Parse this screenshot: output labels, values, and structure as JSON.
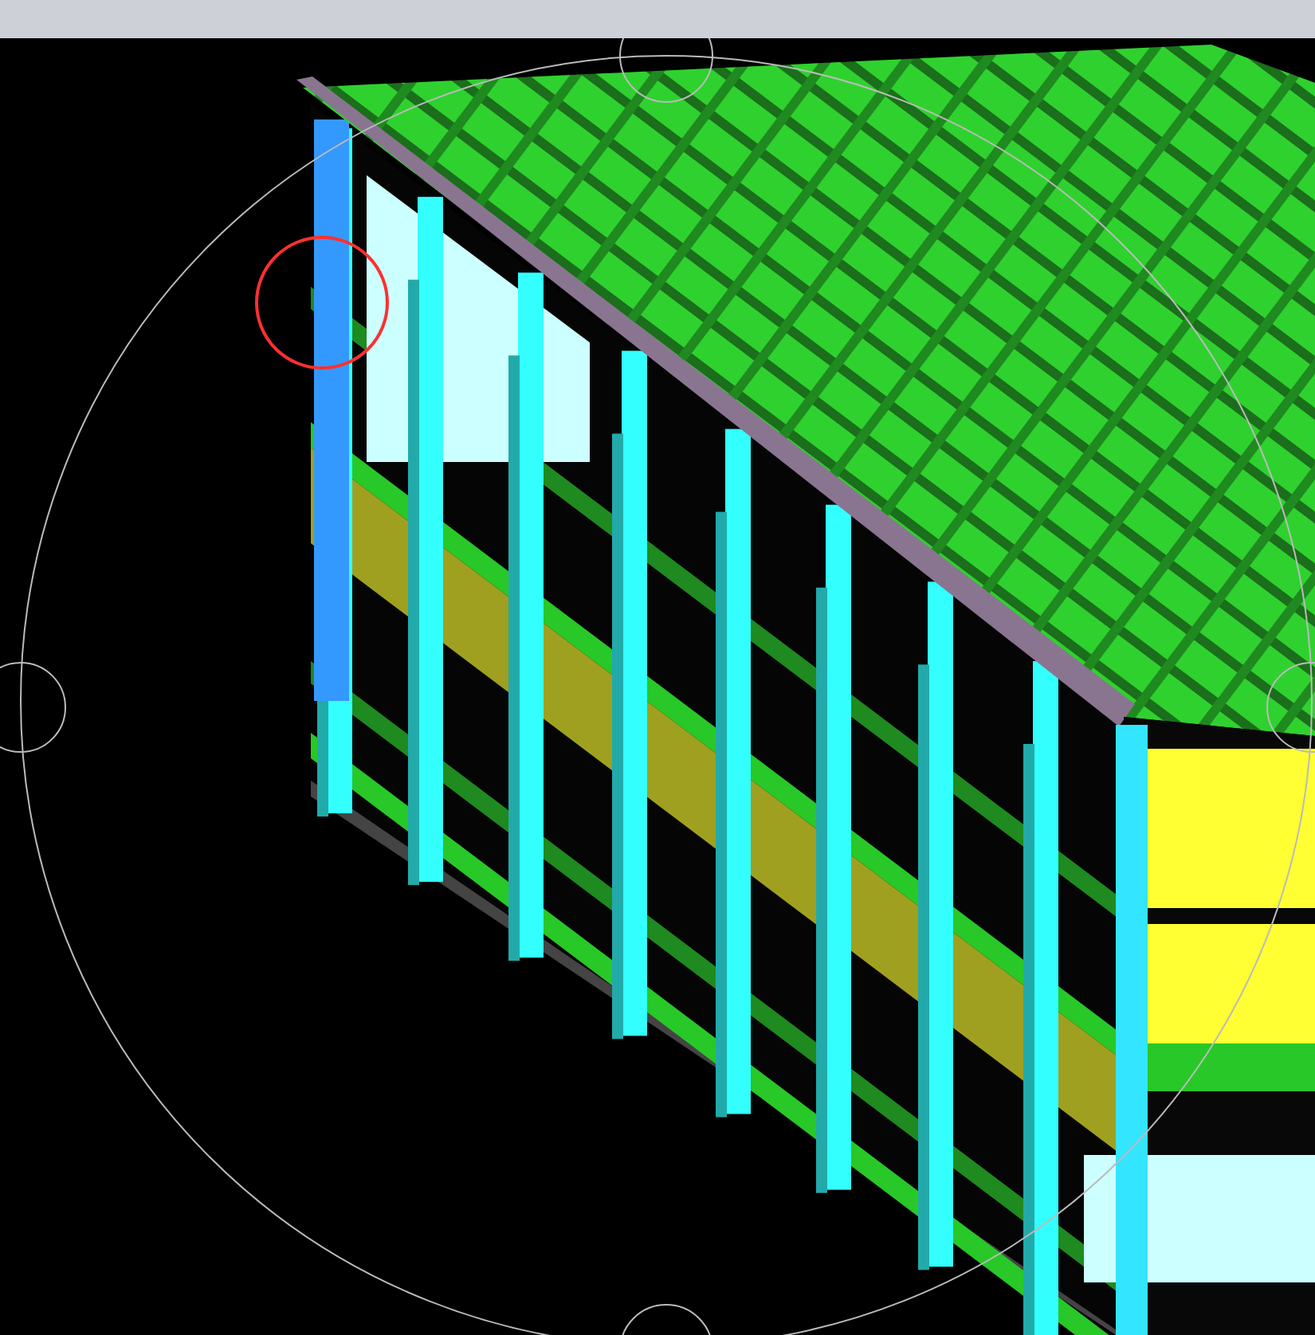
{
  "viewport": {
    "orbit_gizmo": true,
    "selection_marker": true
  }
}
